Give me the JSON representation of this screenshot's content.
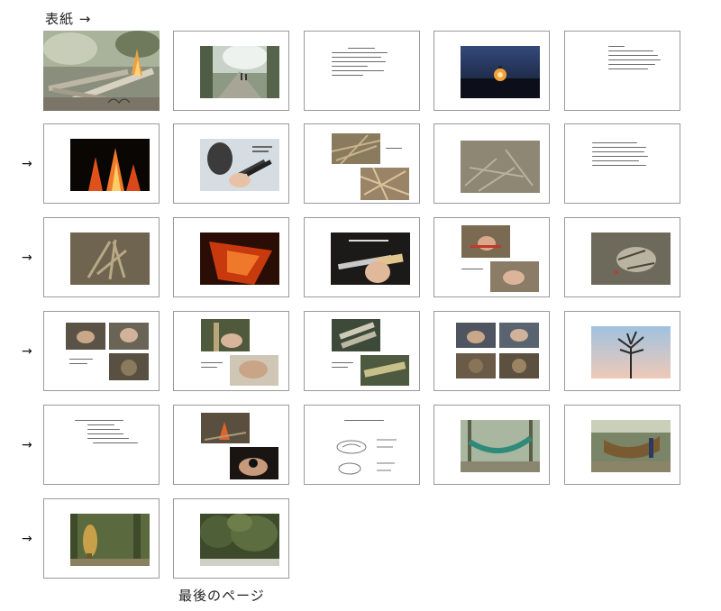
{
  "labels": {
    "cover": "表紙 →",
    "last": "最後のページ"
  },
  "arrow_glyph": "→",
  "colors": {
    "border": "#9a9a9a",
    "text": "#222222"
  }
}
